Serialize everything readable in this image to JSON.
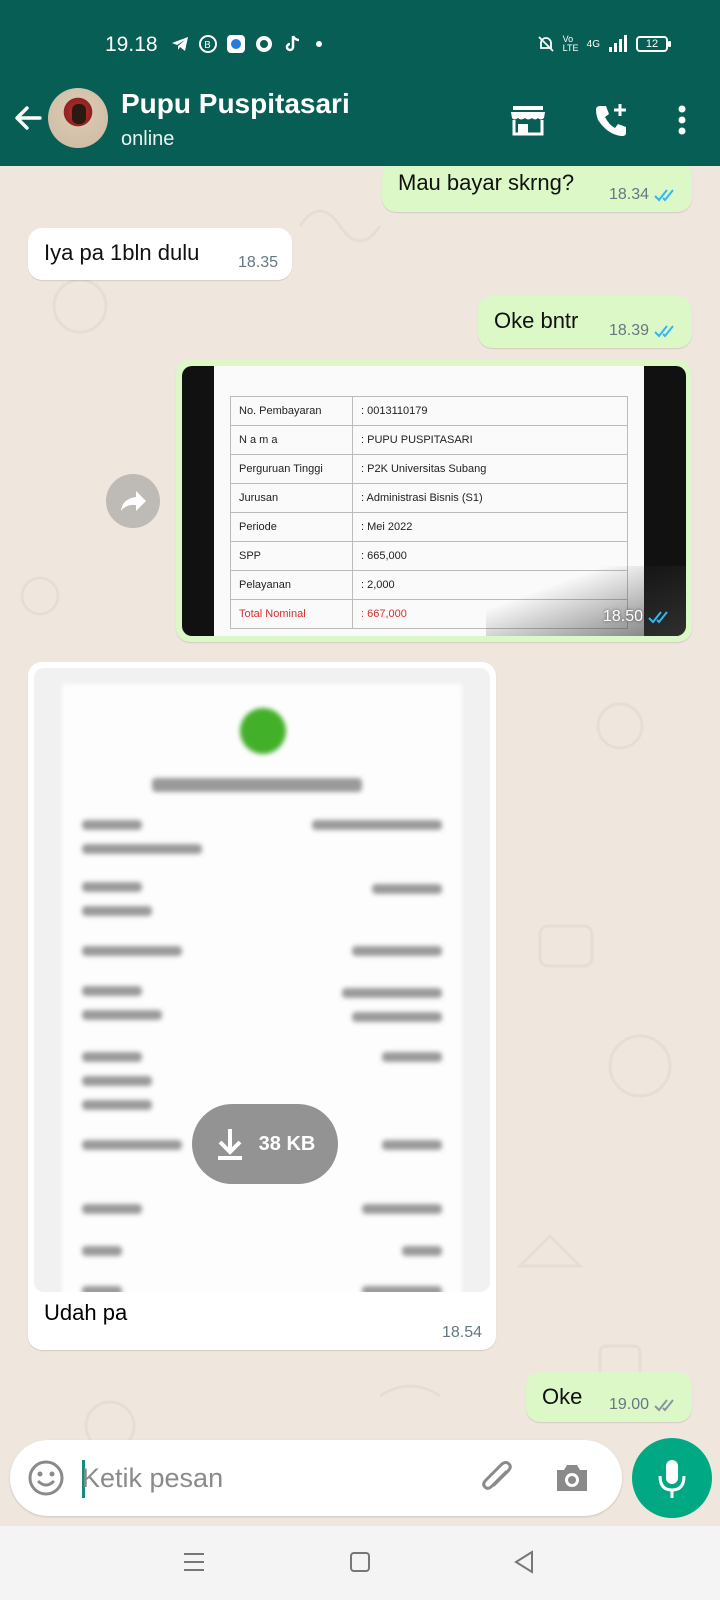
{
  "status_bar": {
    "time": "19.18",
    "battery": "12",
    "network": "4G",
    "volte": "Vo LTE"
  },
  "header": {
    "contact_name": "Pupu Puspitasari",
    "contact_status": "online",
    "icons": [
      "back-arrow-icon",
      "store-icon",
      "add-call-icon",
      "more-vert-icon"
    ]
  },
  "messages": [
    {
      "direction": "out",
      "text": "Mau bayar skrng?",
      "time": "18.34",
      "status": "read"
    },
    {
      "direction": "in",
      "text": "Iya pa 1bln dulu",
      "time": "18.35"
    },
    {
      "direction": "out",
      "text": "Oke bntr",
      "time": "18.39",
      "status": "read"
    },
    {
      "direction": "out",
      "type": "image",
      "time": "18.50",
      "status": "read",
      "image_table": [
        [
          "No. Pembayaran",
          ": 0013110179"
        ],
        [
          "N a m a",
          ": PUPU PUSPITASARI"
        ],
        [
          "Perguruan Tinggi",
          ": P2K Universitas Subang"
        ],
        [
          "Jurusan",
          ": Administrasi Bisnis (S1)"
        ],
        [
          "Periode",
          ": Mei 2022"
        ],
        [
          "SPP",
          ": 665,000"
        ],
        [
          "Pelayanan",
          ": 2,000"
        ],
        [
          "Total Nominal",
          ": 667,000"
        ]
      ]
    },
    {
      "direction": "in",
      "type": "image",
      "download_size": "38 KB",
      "caption": "Udah pa",
      "time": "18.54"
    },
    {
      "direction": "out",
      "text": "Oke",
      "time": "19.00",
      "status": "delivered"
    }
  ],
  "composer": {
    "placeholder": "Ketik pesan"
  },
  "colors": {
    "header": "#075e54",
    "outgoing": "#dcf8c6",
    "incoming": "#ffffff",
    "read_tick": "#34b7f1",
    "mic": "#00a884"
  }
}
